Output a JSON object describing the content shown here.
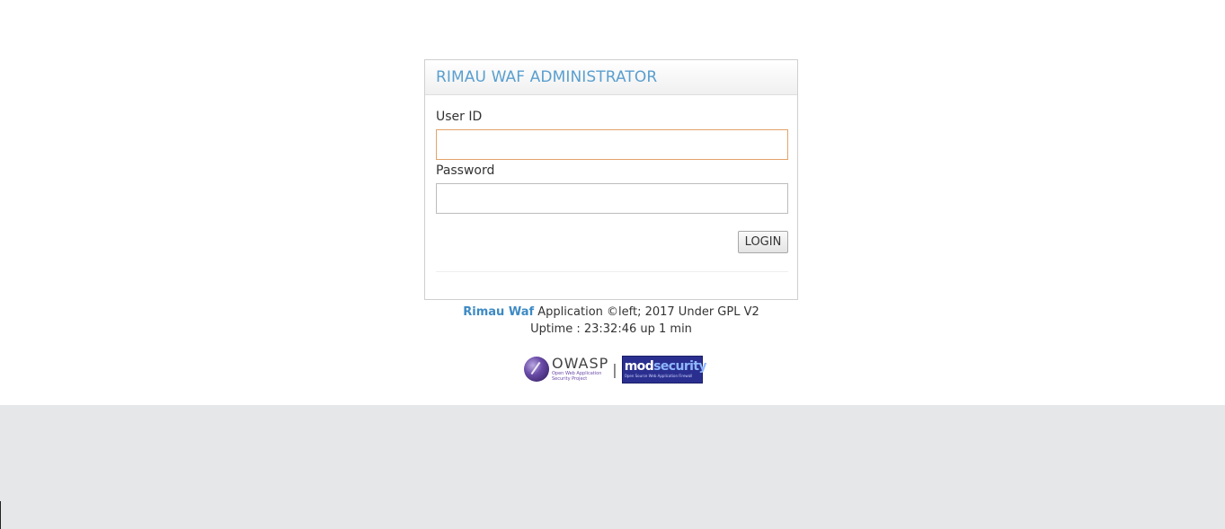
{
  "login_panel": {
    "title": "RIMAU WAF ADMINISTRATOR",
    "user_id_label": "User ID",
    "user_id_value": "",
    "password_label": "Password",
    "password_value": "",
    "login_button": "LOGIN"
  },
  "footer": {
    "brand": "Rimau Waf",
    "copyright": " Application ©left; 2017 Under GPL V2",
    "uptime": "Uptime : 23:32:46 up 1 min"
  },
  "badges": {
    "owasp_name": "OWASP",
    "owasp_tagline": "Open Web Application Security Project",
    "separator": "|",
    "modsec_name_mod": "mod",
    "modsec_name_security": "security",
    "modsec_tagline": "Open Source Web Application Firewall"
  },
  "colors": {
    "title_blue": "#5a9fcf",
    "brand_link": "#3d8ac4",
    "focus_border": "#e3a36a",
    "lower_background": "#e6e7e9",
    "modsecurity_badge": "#2a2f8f",
    "owasp_purple": "#6a4ba8"
  },
  "icons": {
    "owasp_logo": "owasp-wasp-orb-icon"
  }
}
